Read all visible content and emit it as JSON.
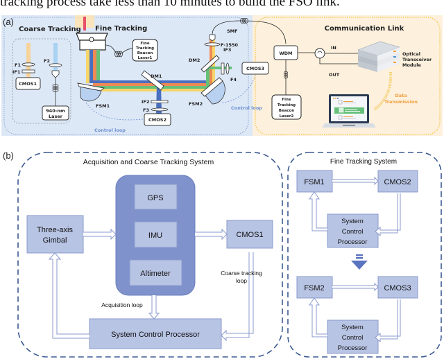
{
  "caption_top": "tracking process take less than 10 minutes to build the FSO link.",
  "panel_a": {
    "label": "(a)",
    "sections": {
      "coarse_tracking": "Coarse Tracking",
      "fine_tracking": "Fine Tracking",
      "communication_link": "Communication Link"
    },
    "components": {
      "f1": "F1",
      "if1": "IF1",
      "cmos1": "CMOS1",
      "f2": "F2",
      "laser940_l1": "940-nm",
      "laser940_l2": "Laser",
      "beacon1": [
        "Fine",
        "Tracking",
        "Beacon",
        "Laser1"
      ],
      "beacon2": [
        "Fine",
        "Tracking",
        "Beacon",
        "Laser2"
      ],
      "fsm1": "FSM1",
      "dm1": "DM1",
      "if2": "IF2",
      "f3": "F3",
      "cmos2": "CMOS2",
      "control_loop_1": "Control loop",
      "smf": "SMF",
      "f1550": "F-1550",
      "dm2": "DM2",
      "if3": "IF3",
      "f4": "F4",
      "cmos3": "CMOS3",
      "fsm2": "FSM2",
      "control_loop_2": "Control loop",
      "wdm": "WDM",
      "in": "IN",
      "out": "OUT",
      "transceiver": [
        "Optical",
        "Transceiver",
        "Module"
      ],
      "data_tx": [
        "Data",
        "Transmission"
      ]
    },
    "colors": {
      "panel_bg": "#dde8f7",
      "comm_bg": "#fdf0dc",
      "beam_blue": "#4a6fc0",
      "beam_orange": "#ef8a55",
      "beam_green": "#66c07a",
      "beam_yellow": "#f6d56a",
      "beam_red": "#e8506a",
      "loop_blue": "#6a8fd0",
      "data_orange": "#f0a040"
    }
  },
  "panel_b": {
    "label": "(b)",
    "acq": {
      "title": "Acquisition and Coarse Tracking System",
      "gimbal": [
        "Three-axis",
        "Gimbal"
      ],
      "gps": "GPS",
      "imu": "IMU",
      "altimeter": "Altimeter",
      "cmos1": "CMOS1",
      "coarse_loop": [
        "Coarse tracking",
        "loop"
      ],
      "acq_loop": "Acquisition loop",
      "scp": "System Control Processor"
    },
    "fine": {
      "title": "Fine Tracking System",
      "fsm1": "FSM1",
      "cmos2": "CMOS2",
      "scp1": [
        "System",
        "Control",
        "Processor"
      ],
      "fsm2": "FSM2",
      "cmos3": "CMOS3",
      "scp2": [
        "System",
        "Control",
        "Processor"
      ]
    },
    "colors": {
      "box_fill": "#b8c4e4",
      "box_stroke": "#8a9acc",
      "sensor_group": "#7f92cc",
      "dash": "#3b5a92",
      "arrow": "#8a9acc"
    }
  }
}
